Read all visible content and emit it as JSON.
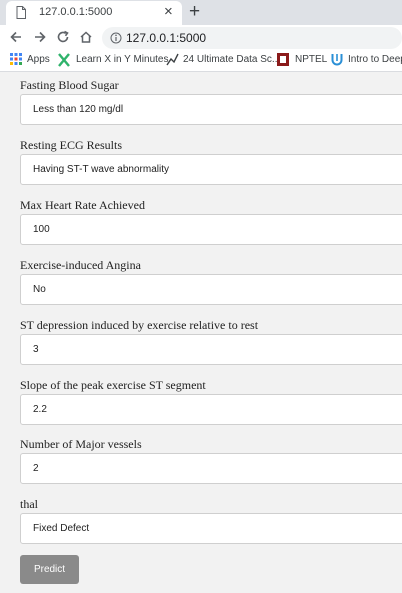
{
  "browser": {
    "tab_title": "127.0.0.1:5000",
    "close_glyph": "×",
    "new_tab_glyph": "+",
    "url": "127.0.0.1:5000",
    "bookmarks": [
      {
        "label": "Apps",
        "icon": "apps-grid-icon"
      },
      {
        "label": "Learn X in Y Minutes",
        "icon": "learn-x-icon"
      },
      {
        "label": "24 Ultimate Data Sc...",
        "icon": "data-sc-icon"
      },
      {
        "label": "NPTEL",
        "icon": "nptel-icon"
      },
      {
        "label": "Intro to Deep",
        "icon": "deep-icon"
      }
    ]
  },
  "form": {
    "fields": [
      {
        "label": "Fasting Blood Sugar",
        "value": "Less than 120 mg/dl"
      },
      {
        "label": "Resting ECG Results",
        "value": "Having ST-T wave abnormality"
      },
      {
        "label": "Max Heart Rate Achieved",
        "value": "100"
      },
      {
        "label": "Exercise-induced Angina",
        "value": "No"
      },
      {
        "label": "ST depression induced by exercise relative to rest",
        "value": "3"
      },
      {
        "label": "Slope of the peak exercise ST segment",
        "value": "2.2"
      },
      {
        "label": "Number of Major vessels",
        "value": "2"
      },
      {
        "label": "thal",
        "value": "Fixed Defect"
      }
    ],
    "submit_label": "Predict"
  }
}
